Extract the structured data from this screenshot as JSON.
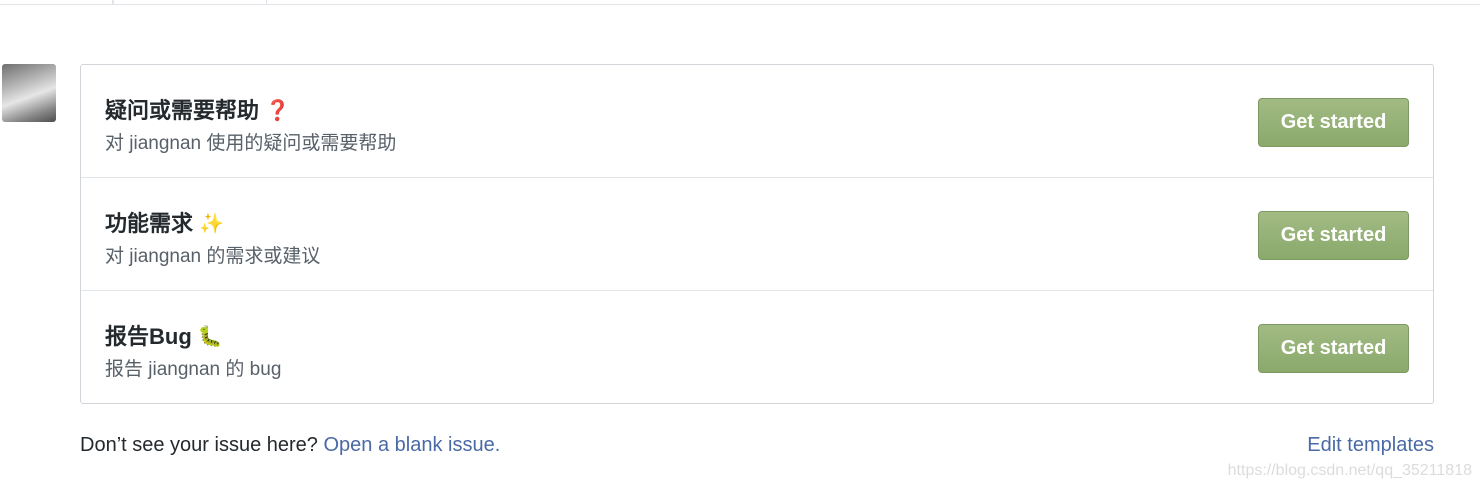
{
  "templates": [
    {
      "title": "疑问或需要帮助",
      "emoji": "❓",
      "emoji_color": "#9b3b2d",
      "description": "对 jiangnan 使用的疑问或需要帮助",
      "button_label": "Get started"
    },
    {
      "title": "功能需求",
      "emoji": "✨",
      "emoji_color": "#e6c770",
      "description": "对 jiangnan 的需求或建议",
      "button_label": "Get started"
    },
    {
      "title": "报告Bug",
      "emoji": "🐛",
      "emoji_color": "#7d8a3a",
      "description": "报告 jiangnan 的 bug",
      "button_label": "Get started"
    }
  ],
  "footer": {
    "prompt": "Don’t see your issue here?",
    "blank_issue_link": "Open a blank issue.",
    "edit_templates_link": "Edit templates"
  },
  "watermark": "https://blog.csdn.net/qq_35211818",
  "colors": {
    "button_green": "#8aa96b",
    "link_blue": "#4a6aa5"
  }
}
